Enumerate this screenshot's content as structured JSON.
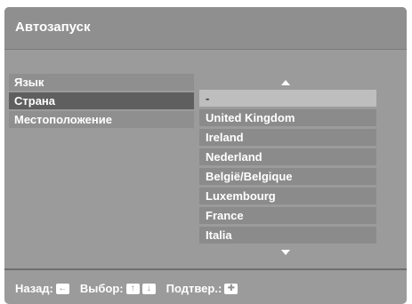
{
  "title": "Автозапуск",
  "left_menu": [
    {
      "label": "Язык"
    },
    {
      "label": "Страна"
    },
    {
      "label": "Местоположение"
    }
  ],
  "country_list": [
    "-",
    "United Kingdom",
    "Ireland",
    "Nederland",
    "België/Belgique",
    "Luxembourg",
    "France",
    "Italia"
  ],
  "footer": {
    "back_label": "Назад:",
    "select_label": "Выбор:",
    "confirm_label": "Подтвер.:"
  },
  "icons": {
    "back_key": "left-arrow-key-icon",
    "select_keys": [
      "up-arrow-key-icon",
      "down-arrow-key-icon"
    ],
    "confirm_key": "enter-key-icon",
    "scroll_up": "scroll-up-arrow-icon",
    "scroll_down": "scroll-down-arrow-icon"
  },
  "colors": {
    "screen_bg": "#9b9b9b",
    "item_bg": "#8f8f8f",
    "selected_bg": "#5f5f5f",
    "highlight_bg": "#bebebe"
  }
}
